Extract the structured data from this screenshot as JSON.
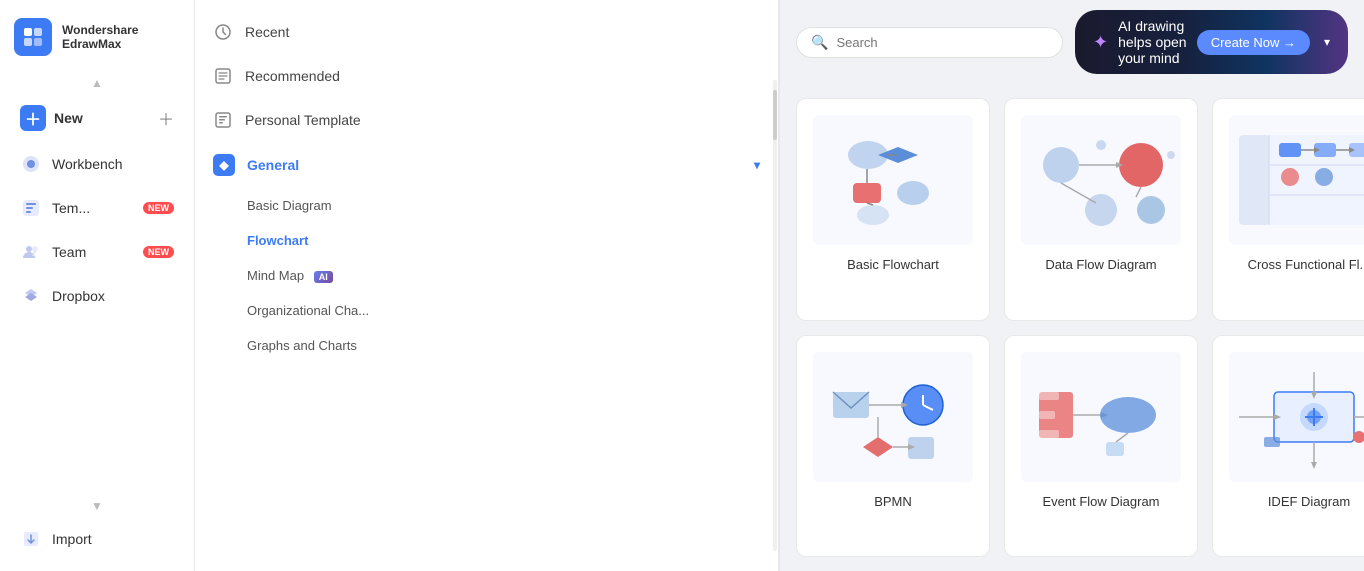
{
  "app": {
    "brand_line1": "Wondershare",
    "brand_line2": "EdrawMax"
  },
  "sidebar": {
    "new_label": "New",
    "workbench_label": "Workbench",
    "templates_label": "Tem...",
    "team_label": "Team",
    "dropbox_label": "Dropbox",
    "import_label": "Import",
    "team_badge": "NEW",
    "templates_badge": "NEW"
  },
  "middle_panel": {
    "recent_label": "Recent",
    "recommended_label": "Recommended",
    "personal_template_label": "Personal Template",
    "general_label": "General",
    "basic_diagram_label": "Basic Diagram",
    "flowchart_label": "Flowchart",
    "mind_map_label": "Mind Map",
    "org_chart_label": "Organizational Cha...",
    "graphs_label": "Graphs and Charts"
  },
  "topbar": {
    "search_placeholder": "Search",
    "ai_text": "AI drawing helps open your mind",
    "ai_cta": "Create Now →"
  },
  "cards": [
    {
      "id": "basic-flowchart",
      "label": "Basic Flowchart"
    },
    {
      "id": "data-flow-diagram",
      "label": "Data Flow Diagram"
    },
    {
      "id": "cross-functional",
      "label": "Cross Functional Fl..."
    },
    {
      "id": "bpmn",
      "label": "BPMN"
    },
    {
      "id": "event-flow-diagram",
      "label": "Event Flow Diagram"
    },
    {
      "id": "idef-diagram",
      "label": "IDEF Diagram"
    }
  ]
}
